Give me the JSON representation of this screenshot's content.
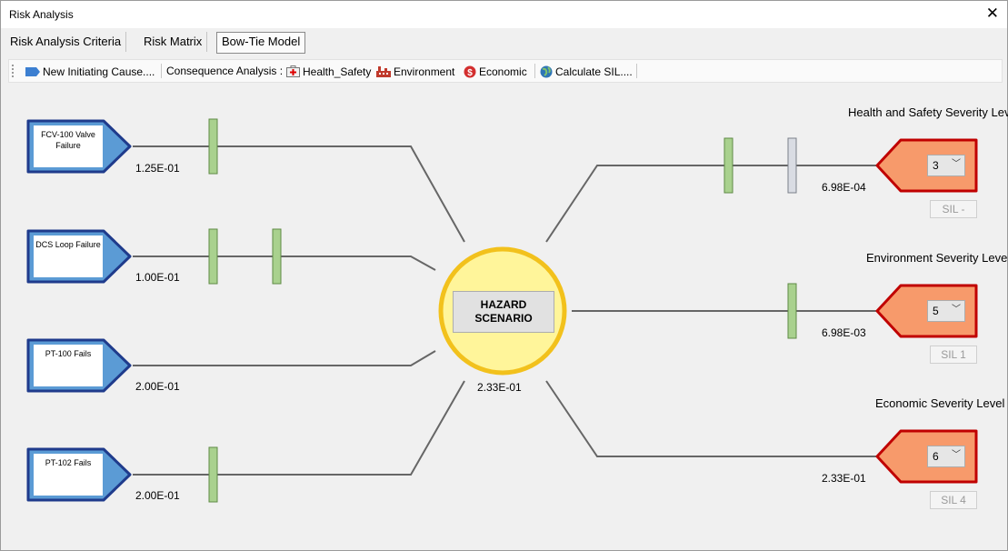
{
  "window": {
    "title": "Risk Analysis",
    "close_glyph": "✕"
  },
  "tabs": [
    {
      "label": "Risk Analysis Criteria"
    },
    {
      "label": "Risk Matrix"
    },
    {
      "label": "Bow-Tie Model",
      "active": true
    }
  ],
  "toolbar": {
    "new_cause": "New Initiating Cause....",
    "consequence_label": "Consequence Analysis :",
    "health_safety": "Health_Safety",
    "environment": "Environment",
    "economic": "Economic",
    "calculate_sil": "Calculate SIL...."
  },
  "causes": [
    {
      "name": "FCV-100 Valve Failure",
      "frequency": "1.25E-01",
      "barriers": 1
    },
    {
      "name": "DCS Loop Failure",
      "frequency": "1.00E-01",
      "barriers": 2
    },
    {
      "name": "PT-100 Fails",
      "frequency": "2.00E-01",
      "barriers": 0
    },
    {
      "name": "PT-102 Fails",
      "frequency": "2.00E-01",
      "barriers": 1
    }
  ],
  "hazard": {
    "label": "HAZARD SCENARIO",
    "frequency": "2.33E-01"
  },
  "consequences": [
    {
      "severity_title": "Health and Safety Severity Level",
      "severity_value": "3",
      "frequency": "6.98E-04",
      "sil": "SIL -",
      "barriers": 2
    },
    {
      "severity_title": "Environment Severity Level",
      "severity_value": "5",
      "frequency": "6.98E-03",
      "sil": "SIL 1",
      "barriers": 1
    },
    {
      "severity_title": "Economic Severity Level",
      "severity_value": "6",
      "frequency": "2.33E-01",
      "sil": "SIL 4",
      "barriers": 0
    }
  ],
  "colors": {
    "cause_fill": "#5b9bd5",
    "cause_border": "#1f3b8c",
    "consequence_fill": "#f79a6b",
    "consequence_border": "#c00000",
    "hazard_fill": "#fff59a",
    "hazard_ring": "#f2c11c",
    "barrier_green": "#a9d18e",
    "barrier_gray": "#d9dce3",
    "line": "#666666"
  }
}
